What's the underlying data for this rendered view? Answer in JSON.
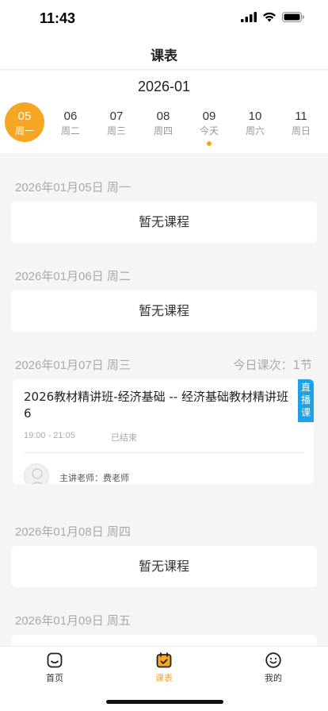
{
  "status_bar": {
    "time": "11:43"
  },
  "nav": {
    "title": "课表"
  },
  "week": {
    "month": "2026-01",
    "days": [
      {
        "num": "05",
        "weekday": "周一"
      },
      {
        "num": "06",
        "weekday": "周二"
      },
      {
        "num": "07",
        "weekday": "周三"
      },
      {
        "num": "08",
        "weekday": "周四"
      },
      {
        "num": "09",
        "weekday": "今天"
      },
      {
        "num": "10",
        "weekday": "周六"
      },
      {
        "num": "11",
        "weekday": "周日"
      }
    ],
    "selected_index": 0,
    "today_index": 4
  },
  "schedule": [
    {
      "date": "2026年01月05日  周一",
      "empty_text": "暂无课程"
    },
    {
      "date": "2026年01月06日  周二",
      "empty_text": "暂无课程"
    },
    {
      "date": "2026年01月07日  周三",
      "summary": "今日课次：1节",
      "course": {
        "title": "2026教材精讲班-经济基础 -- 经济基础教材精讲班 6",
        "time": "19:00 - 21:05",
        "status": "已结束",
        "tag": "直播课",
        "teacher": "主讲老师：费老师"
      }
    },
    {
      "date": "2026年01月08日  周四",
      "empty_text": "暂无课程"
    },
    {
      "date": "2026年01月09日  周五"
    }
  ],
  "tabs": [
    {
      "label": "首页",
      "icon": "home-icon"
    },
    {
      "label": "课表",
      "icon": "calendar-icon",
      "active": true
    },
    {
      "label": "我的",
      "icon": "smiley-icon"
    }
  ],
  "colors": {
    "accent": "#f5a623",
    "live_tag": "#1aa3e8"
  }
}
